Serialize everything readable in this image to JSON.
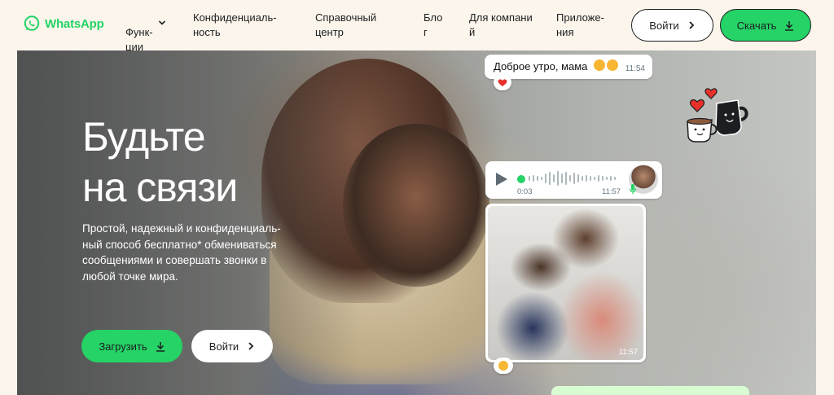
{
  "header": {
    "logo_text": "WhatsApp",
    "nav": [
      {
        "label": "Функ-\nции"
      },
      {
        "label": "Конфиденциаль-\nность"
      },
      {
        "label": "Справочный\nцентр"
      },
      {
        "label": "Бло\nг"
      },
      {
        "label": "Для компани\nй"
      },
      {
        "label": "Приложе-\nния"
      }
    ],
    "login_label": "Войти",
    "download_label": "Скачать"
  },
  "hero": {
    "title": "Будьте\nна связи",
    "subtitle": "Простой, надежный и конфиденциаль-\nный способ бесплатно* обмениваться\nсообщениями и совершать звонки в\nлюбой точке мира.",
    "download_label": "Загрузить",
    "login_label": "Войти"
  },
  "chat": {
    "greeting_text": "Доброе утро, мама",
    "greeting_time": "11:54",
    "voice_duration": "0:03",
    "voice_time": "11:57",
    "photo_time": "11:57"
  },
  "colors": {
    "brand_green": "#25d366",
    "background": "#fcf5eb",
    "text_dark": "#1c1e21",
    "reaction_heart": "#e8302a"
  },
  "icons": {
    "logo": "whatsapp-logo-icon",
    "dropdown": "chevron-down-icon",
    "arrow": "chevron-right-icon",
    "download": "download-icon",
    "play": "play-icon",
    "mic": "mic-icon"
  }
}
